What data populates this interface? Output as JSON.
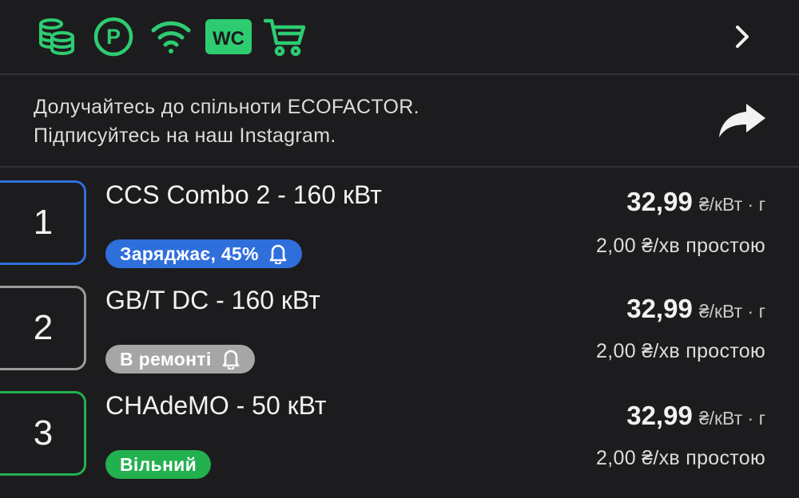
{
  "colors": {
    "background": "#1c1c1e",
    "amenity_green": "#2ecc71",
    "charging_blue": "#2f6fdc",
    "repair_gray": "#a6a6a6",
    "free_green": "#23b04f"
  },
  "amenities": {
    "icons": [
      "database-coins-icon",
      "parking-icon",
      "wifi-icon",
      "wc-icon",
      "shopping-cart-icon"
    ],
    "wc_label": "WC",
    "parking_label": "P"
  },
  "promo": {
    "line1": "Долучайтесь до спільноти ECOFACTOR.",
    "line2": "Підписуйтесь на наш Instagram."
  },
  "connectors": [
    {
      "number": "1",
      "title": "CCS Combo 2 - 160 кВт",
      "status": "Заряджає, 45%",
      "status_color": "#2f6fdc",
      "border_color": "#2f6fdc",
      "has_bell": true,
      "price": "32,99",
      "price_unit": "₴/кВт · г",
      "idle": "2,00 ₴/хв простою"
    },
    {
      "number": "2",
      "title": "GB/T DC - 160 кВт",
      "status": "В ремонті",
      "status_color": "#a6a6a6",
      "border_color": "#9a9a9a",
      "has_bell": true,
      "price": "32,99",
      "price_unit": "₴/кВт · г",
      "idle": "2,00 ₴/хв простою"
    },
    {
      "number": "3",
      "title": "CHAdeMO - 50 кВт",
      "status": "Вільний",
      "status_color": "#23b04f",
      "border_color": "#23b04f",
      "has_bell": false,
      "price": "32,99",
      "price_unit": "₴/кВт · г",
      "idle": "2,00 ₴/хв простою"
    }
  ]
}
